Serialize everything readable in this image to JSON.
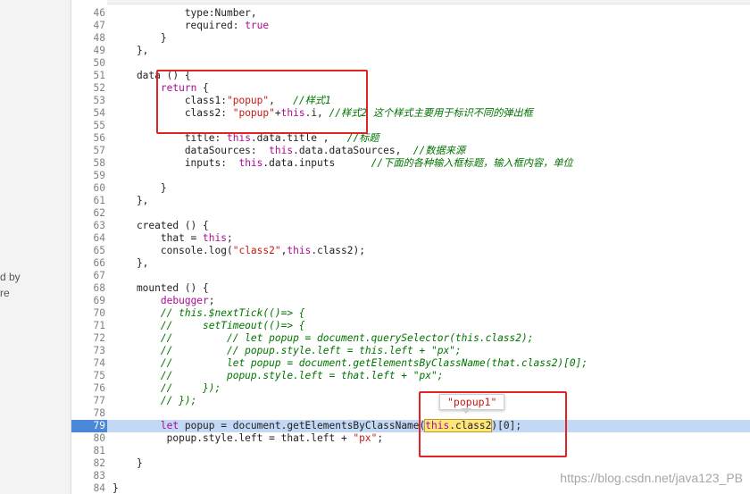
{
  "sidebar": {
    "fragments": [
      "d by",
      "re"
    ]
  },
  "tooltip": {
    "value": "\"popup1\""
  },
  "watermark": "https://blog.csdn.net/java123_PB",
  "lines": [
    {
      "n": "46",
      "t": "            type:Number,"
    },
    {
      "n": "47",
      "t": "            required: true"
    },
    {
      "n": "48",
      "t": "        }"
    },
    {
      "n": "49",
      "t": "    },"
    },
    {
      "n": "50",
      "t": ""
    },
    {
      "n": "51",
      "t": "    data () {"
    },
    {
      "n": "52",
      "t": "        return {"
    },
    {
      "n": "53",
      "t": "            class1:\"popup\",   //样式1"
    },
    {
      "n": "54",
      "t": "            class2: \"popup\"+this.i, //样式2 这个样式主要用于标识不同的弹出框"
    },
    {
      "n": "55",
      "t": ""
    },
    {
      "n": "56",
      "t": "            title: this.data.title ,   //标题"
    },
    {
      "n": "57",
      "t": "            dataSources:  this.data.dataSources,  //数据来源"
    },
    {
      "n": "58",
      "t": "            inputs:  this.data.inputs      //下面的各种输入框标题，输入框内容，单位"
    },
    {
      "n": "59",
      "t": ""
    },
    {
      "n": "60",
      "t": "        }"
    },
    {
      "n": "61",
      "t": "    },"
    },
    {
      "n": "62",
      "t": ""
    },
    {
      "n": "63",
      "t": "    created () {"
    },
    {
      "n": "64",
      "t": "        that = this;"
    },
    {
      "n": "65",
      "t": "        console.log(\"class2\",this.class2);"
    },
    {
      "n": "66",
      "t": "    },"
    },
    {
      "n": "67",
      "t": ""
    },
    {
      "n": "68",
      "t": "    mounted () {"
    },
    {
      "n": "69",
      "t": "        debugger;"
    },
    {
      "n": "70",
      "t": "        // this.$nextTick(()=> {"
    },
    {
      "n": "71",
      "t": "        //     setTimeout(()=> {"
    },
    {
      "n": "72",
      "t": "        //         // let popup = document.querySelector(this.class2);"
    },
    {
      "n": "73",
      "t": "        //         // popup.style.left = this.left + \"px\";"
    },
    {
      "n": "74",
      "t": "        //         let popup = document.getElementsByClassName(that.class2)[0];"
    },
    {
      "n": "75",
      "t": "        //         popup.style.left = that.left + \"px\";"
    },
    {
      "n": "76",
      "t": "        //     });"
    },
    {
      "n": "77",
      "t": "        // });"
    },
    {
      "n": "78",
      "t": ""
    },
    {
      "n": "79",
      "t": "        let popup = document.getElementsByClassName(this.class2)[0];"
    },
    {
      "n": "80",
      "t": "         popup.style.left = that.left + \"px\";"
    },
    {
      "n": "81",
      "t": ""
    },
    {
      "n": "82",
      "t": "    }"
    },
    {
      "n": "83",
      "t": ""
    },
    {
      "n": "84",
      "t": "}"
    }
  ],
  "colors": {
    "highlight_row": "#c2d8f5",
    "annotation_red": "#e02424"
  }
}
